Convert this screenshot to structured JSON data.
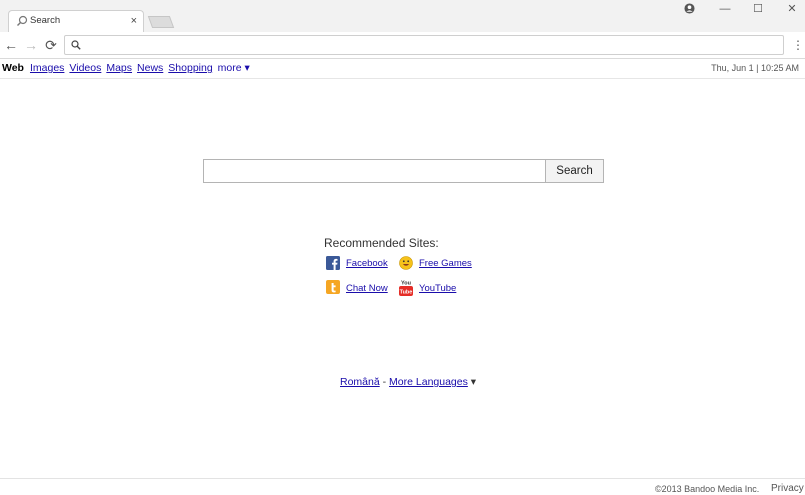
{
  "browser": {
    "tab_title": "Search",
    "tab_close": "×",
    "minimize": "—",
    "maximize": "☐",
    "close": "✕",
    "back": "←",
    "forward": "→",
    "reload": "⟳",
    "menu": "⋮",
    "address_value": ""
  },
  "search_nav": {
    "active": "Web",
    "links": [
      "Images",
      "Videos",
      "Maps",
      "News",
      "Shopping"
    ],
    "more": "more ▾",
    "datetime": "Thu, Jun 1 | 10:25 AM"
  },
  "search": {
    "value": "",
    "button_label": "Search"
  },
  "recommended": {
    "title": "Recommended Sites:",
    "sites": [
      {
        "label": "Facebook",
        "icon": "facebook-icon",
        "color": "#3b5998"
      },
      {
        "label": "Free Games",
        "icon": "smiley-icon",
        "color": "#f6c21a"
      },
      {
        "label": "Chat Now",
        "icon": "chat-icon",
        "color": "#f5a623"
      },
      {
        "label": "YouTube",
        "icon": "youtube-icon",
        "color": "#e52d27"
      }
    ]
  },
  "languages": {
    "current": "Română",
    "separator": "-",
    "more": "More Languages",
    "arrow": "▾"
  },
  "footer": {
    "copyright": "©2013 Bandoo Media Inc.",
    "privacy": "Privacy"
  },
  "colors": {
    "link": "#1a0dab",
    "titlebar": "#f2f2f2"
  }
}
